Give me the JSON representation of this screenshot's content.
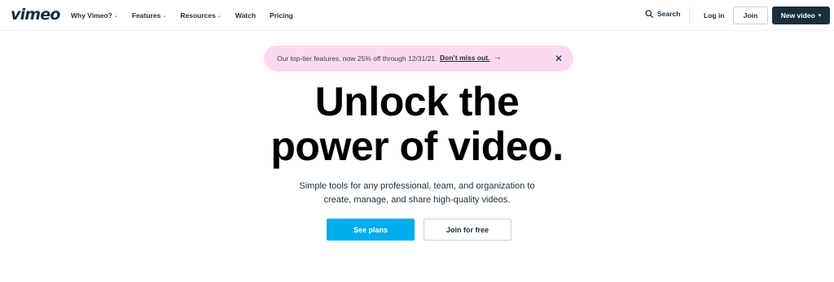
{
  "header": {
    "logo_text": "vimeo",
    "nav": [
      {
        "label": "Why Vimeo?",
        "has_dropdown": true
      },
      {
        "label": "Features",
        "has_dropdown": true
      },
      {
        "label": "Resources",
        "has_dropdown": true
      },
      {
        "label": "Watch",
        "has_dropdown": false
      },
      {
        "label": "Pricing",
        "has_dropdown": false
      }
    ],
    "search_label": "Search",
    "login_label": "Log in",
    "join_label": "Join",
    "new_video_label": "New video"
  },
  "promo": {
    "text": "Our top-tier features, now 25% off through 12/31/21.",
    "link_label": "Don’t miss out.",
    "arrow": "→",
    "close": "✕",
    "background": "#fcd9ef"
  },
  "hero": {
    "title_line1": "Unlock the",
    "title_line2": "power of video.",
    "subtitle_line1": "Simple tools for any professional, team, and organization to",
    "subtitle_line2": "create, manage, and share high-quality videos.",
    "primary_cta": "See plans",
    "secondary_cta": "Join for free"
  },
  "colors": {
    "brand_dark": "#1a2e3b",
    "accent_blue": "#00adef"
  }
}
